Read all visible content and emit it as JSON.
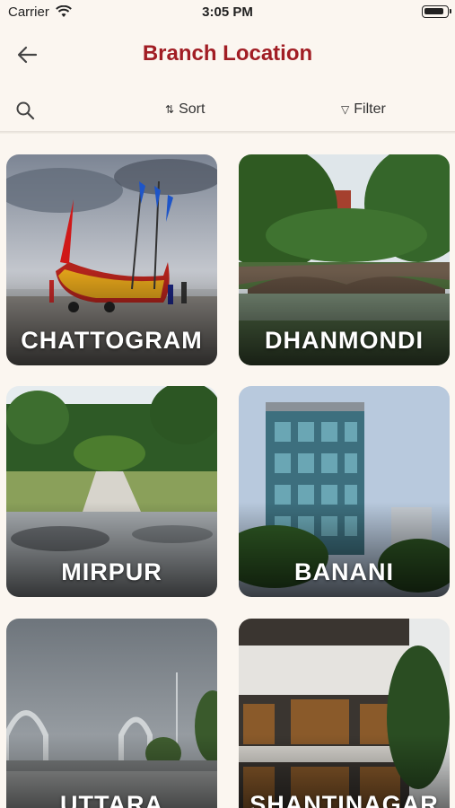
{
  "status": {
    "carrier": "Carrier",
    "time": "3:05 PM"
  },
  "header": {
    "title": "Branch Location"
  },
  "toolbar": {
    "sort_label": "Sort",
    "filter_label": "Filter"
  },
  "branches": [
    {
      "name": "CHATTOGRAM"
    },
    {
      "name": "DHANMONDI"
    },
    {
      "name": "MIRPUR"
    },
    {
      "name": "BANANI"
    },
    {
      "name": "UTTARA"
    },
    {
      "name": "SHANTINAGAR"
    }
  ],
  "colors": {
    "title": "#a11d24",
    "background": "#fbf6f0"
  }
}
